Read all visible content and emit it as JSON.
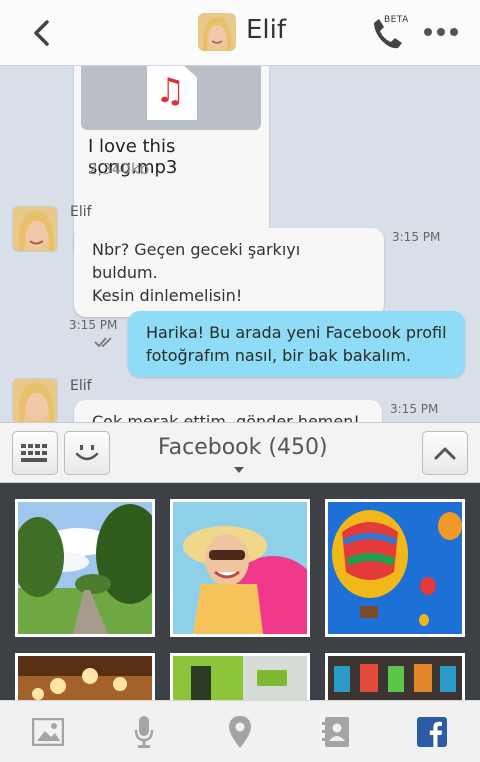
{
  "header": {
    "contact_name": "Elif",
    "beta_label": "BETA"
  },
  "file_message": {
    "file_name": "I love this song.mp3",
    "file_size": "2,340kb"
  },
  "messages": [
    {
      "direction": "in",
      "sender": "Elif",
      "lines": [
        "Nbr? Geçen geceki şarkıyı buldum.",
        "Kesin dinlemelisin!"
      ],
      "time": "3:15 PM"
    },
    {
      "direction": "out",
      "lines": [
        "Harika! Bu arada yeni Facebook profil",
        "fotoğrafım nasıl, bir bak bakalım."
      ],
      "time": "3:15 PM"
    },
    {
      "direction": "in",
      "sender": "Elif",
      "lines": [
        "Çok merak ettim, gönder hemen!"
      ],
      "time": "3:15 PM"
    }
  ],
  "picker": {
    "album_title": "Facebook (450)"
  },
  "photos": [
    "park-path",
    "woman-pink-hat",
    "hot-air-balloons",
    "restaurant-lamps",
    "green-interior",
    "market-stall"
  ],
  "bottom_bar": [
    "gallery-icon",
    "microphone-icon",
    "location-pin-icon",
    "contacts-icon",
    "facebook-icon"
  ],
  "colors": {
    "outgoing_bubble": "#8fdcf6",
    "incoming_bubble": "#f7f7f7",
    "chat_background": "#d9dfe8",
    "facebook_blue": "#2b5aa6"
  }
}
